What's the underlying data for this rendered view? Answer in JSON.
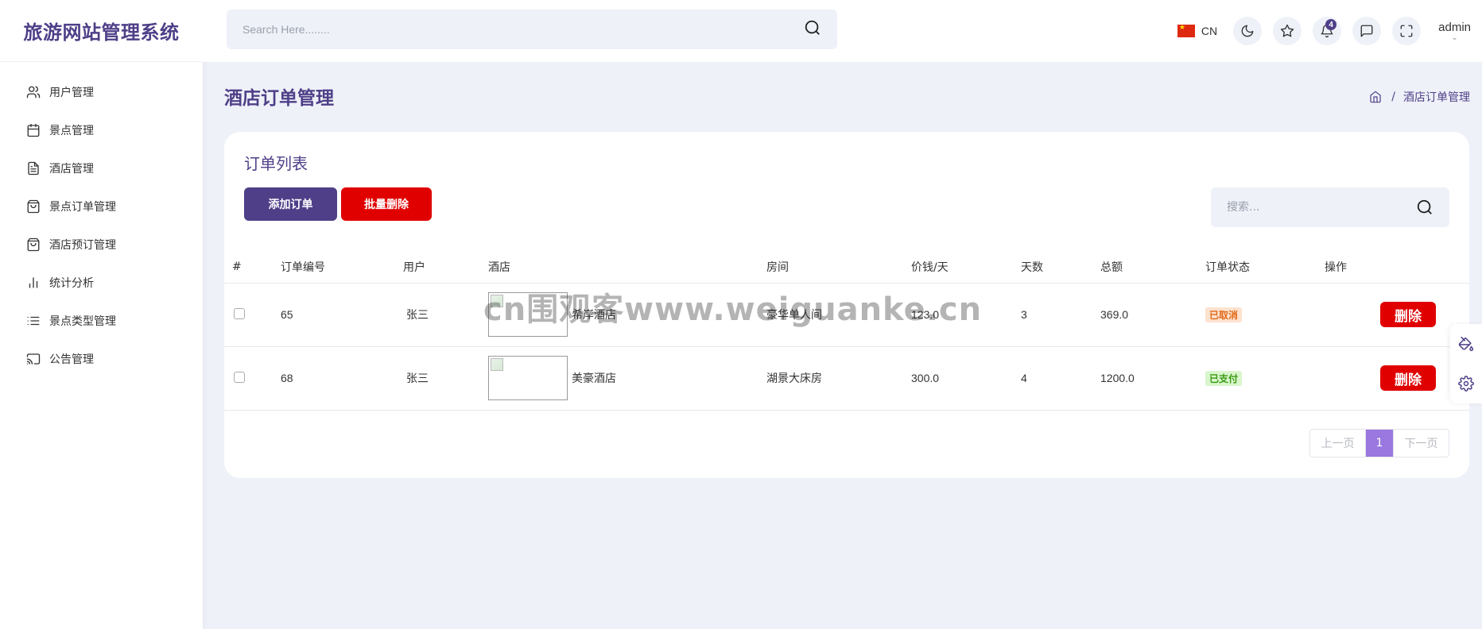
{
  "brand": "旅游网站管理系统",
  "sidebar": {
    "items": [
      {
        "label": "用户管理",
        "icon": "users-icon"
      },
      {
        "label": "景点管理",
        "icon": "calendar-icon"
      },
      {
        "label": "酒店管理",
        "icon": "file-icon"
      },
      {
        "label": "景点订单管理",
        "icon": "shopping-bag-icon"
      },
      {
        "label": "酒店预订管理",
        "icon": "shopping-bag-icon"
      },
      {
        "label": "统计分析",
        "icon": "bar-chart-icon"
      },
      {
        "label": "景点类型管理",
        "icon": "list-icon"
      },
      {
        "label": "公告管理",
        "icon": "cast-icon"
      }
    ]
  },
  "header": {
    "search_placeholder": "Search Here........",
    "language": "CN",
    "notification_count": "4",
    "user": "admin",
    "user_chevron": "⌄"
  },
  "page": {
    "title": "酒店订单管理",
    "breadcrumb_sep": "/",
    "breadcrumb_current": "酒店订单管理"
  },
  "card": {
    "title": "订单列表",
    "add_button": "添加订单",
    "batch_delete_button": "批量删除",
    "search_placeholder": "搜索..."
  },
  "table": {
    "headers": [
      "#",
      "订单编号",
      "用户",
      "酒店",
      "房间",
      "价钱/天",
      "天数",
      "总额",
      "订单状态",
      "操作"
    ],
    "rows": [
      {
        "id": "65",
        "user": "张三",
        "hotel": "希岸酒店",
        "room": "豪华单人间",
        "price": "123.0",
        "days": "3",
        "total": "369.0",
        "status": "已取消",
        "action": "删除"
      },
      {
        "id": "68",
        "user": "张三",
        "hotel": "美豪酒店",
        "room": "湖景大床房",
        "price": "300.0",
        "days": "4",
        "total": "1200.0",
        "status": "已支付",
        "action": "删除"
      }
    ]
  },
  "pagination": {
    "prev": "上一页",
    "current": "1",
    "next": "下一页"
  },
  "watermark": "cn围观客www.weiguanke.cn",
  "colors": {
    "accent": "#4f3f88",
    "danger": "#e00000",
    "background": "#eef1f8",
    "pager_active": "#9a78df"
  }
}
